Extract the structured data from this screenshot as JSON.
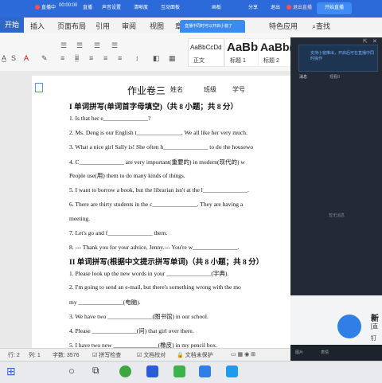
{
  "live_bar": {
    "items": [
      "直播中",
      "00:00:00",
      "直播",
      "声音设置",
      "清晰度",
      "互动面板",
      "画板",
      "分享",
      "退出",
      "退出直播"
    ],
    "start_button": "开始直播"
  },
  "popup": {
    "text": "直播中同时可以开启小窗了"
  },
  "ribbon": {
    "tabs": [
      "开始",
      "插入",
      "页面布局",
      "引用",
      "审阅",
      "视图",
      "章",
      "特色应用"
    ],
    "search": "查找"
  },
  "styles": [
    {
      "sample": "AaBbCcDd",
      "label": "正文"
    },
    {
      "sample": "AaBb",
      "label": "标题 1"
    },
    {
      "sample": "AaBb(",
      "label": "标题 2"
    }
  ],
  "document": {
    "title": "作业卷三",
    "meta": [
      "姓名",
      "班级",
      "学号"
    ],
    "section1": "I 单词拼写(单词首字母填空)（共 8 小题；共 8 分）",
    "lines1": [
      "1. Is that her e_______________?",
      "2. Ms. Deng is our English t_______________. We all like her very much.",
      "3. What a nice girl Sally is! She often h_______________ to do the housewo",
      "4. C_______________ are very important(重要的) in modern(现代的) w",
      "People use(用) them to do many kinds of things.",
      "5. I want to borrow a book, but the librarian isn't at the l_______________.",
      "6. There are thirty students in the c_______________. They are having a",
      "meeting.",
      "7. Let's go and f_______________ them.",
      "8. --- Thank you for your advice, Jenny.--- You're w_______________."
    ],
    "section2": "II 单词拼写(根据中文提示拼写单词)（共 8 小题；共 8 分）",
    "lines2": [
      "1. Please look up the new words in your _______________(字典).",
      "2. I'm going to send an e-mail, but there's something wrong with the mo",
      "my _______________(电脑).",
      "3. We have two _______________(图书馆) in our school.",
      "4. Please _______________(问) that girl over there.",
      "5. I have two new _______________(橡皮) in my pencil box."
    ]
  },
  "status_bar": {
    "row": "行: 2",
    "col": "列: 1",
    "words": "字数: 3576",
    "spell": "拼写检查",
    "proof": "文档校对",
    "unprotected": "文档未保护"
  },
  "right_panel": {
    "header_text": "支持小窗推出，开启后可在直播中同时操作",
    "tab_active": "消息",
    "tab_inactive": "观看0",
    "empty_text": "暂无消息",
    "new_title": "新",
    "new_sub1": "[直",
    "new_sub2": "钉",
    "bottom_left": "图片",
    "bottom_right": "表情"
  }
}
